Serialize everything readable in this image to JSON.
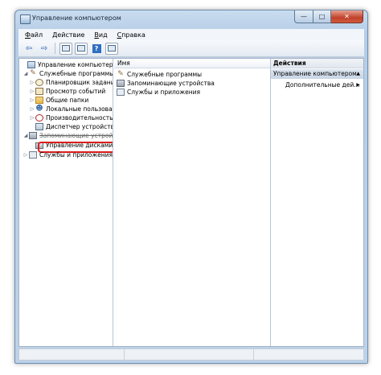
{
  "window": {
    "title": "Управление компьютером"
  },
  "controls": {
    "minimize": "—",
    "maximize": "□",
    "close": "✕"
  },
  "menu": [
    {
      "hot": "Ф",
      "rest": "айл"
    },
    {
      "hot": "Д",
      "rest": "ействие"
    },
    {
      "hot": "В",
      "rest": "ид"
    },
    {
      "hot": "С",
      "rest": "правка"
    }
  ],
  "toolbar": {
    "back": "⇦",
    "forward": "⇨",
    "help": "?"
  },
  "tree": {
    "root": "Управление компьютером (л",
    "utilities": "Служебные программы",
    "task_scheduler": "Планировщик заданий",
    "event_viewer": "Просмотр событий",
    "shared_folders": "Общие папки",
    "local_users": "Локальные пользовате",
    "performance": "Производительность",
    "device_manager": "Диспетчер устройств",
    "storage": "Запоминающие устройства",
    "disk_management": "Управление дисками",
    "services": "Службы и приложения"
  },
  "middle": {
    "column_name": "Имя",
    "items": [
      "Служебные программы",
      "Запоминающие устройства",
      "Службы и приложения"
    ]
  },
  "actions": {
    "header": "Действия",
    "section": "Управление компьютером",
    "more": "Дополнительные дей..."
  },
  "icons": {
    "expanded": "◢",
    "collapsed": "▷",
    "section_up": "▲",
    "submenu": "▶"
  }
}
